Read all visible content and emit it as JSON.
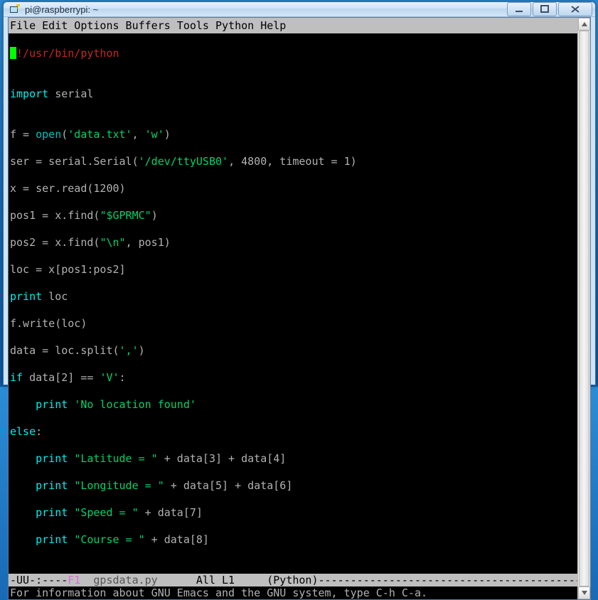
{
  "window": {
    "title": "pi@raspberrypi: ~"
  },
  "menubar": "File Edit Options Buffers Tools Python Help",
  "code": {
    "shebang_bang": "#",
    "shebang_rest": "!/usr/bin/python",
    "blank": "",
    "l_import": "import",
    "l_import_mod": " serial",
    "l_fopen_1": "f = ",
    "l_fopen_open": "open",
    "l_fopen_2": "(",
    "l_fopen_s1": "'data.txt'",
    "l_fopen_3": ", ",
    "l_fopen_s2": "'w'",
    "l_fopen_4": ")",
    "l_ser_1": "ser = serial.Serial(",
    "l_ser_s1": "'/dev/ttyUSB0'",
    "l_ser_2": ", 4800, timeout = 1)",
    "l_x": "x = ser.read(1200)",
    "l_pos1_1": "pos1 = x.find(",
    "l_pos1_s": "\"$GPRMC\"",
    "l_pos1_2": ")",
    "l_pos2_1": "pos2 = x.find(",
    "l_pos2_s": "\"\\n\"",
    "l_pos2_2": ", pos1)",
    "l_loc": "loc = x[pos1:pos2]",
    "l_print_kw": "print",
    "l_print_loc": " loc",
    "l_fwrite": "f.write(loc)",
    "l_data_1": "data = loc.split(",
    "l_data_s": "','",
    "l_data_2": ")",
    "l_if_kw": "if",
    "l_if_1": " data[2] == ",
    "l_if_s": "'V'",
    "l_if_2": ":",
    "l_nlf_1": "    ",
    "l_nlf_s": "'No location found'",
    "l_else_kw": "else",
    "l_else_c": ":",
    "l_lat_s": "\"Latitude = \"",
    "l_lat_2": " + data[3] + data[4]",
    "l_lon_s": "\"Longitude = \"",
    "l_lon_2": " + data[5] + data[6]",
    "l_spd_s": "\"Speed = \"",
    "l_spd_2": " + data[7]",
    "l_crs_s": "\"Course = \"",
    "l_crs_2": " + data[8]",
    "indent4": "    ",
    "space": " "
  },
  "modeline": {
    "left": "-UU-:----",
    "f1": "F1",
    "gap1": "  ",
    "file": "gpsdata.py",
    "gap2": "      ",
    "pos": "All L1",
    "gap3": "     ",
    "mode": "(Python)",
    "dash": "---------------------------------------------"
  },
  "echo": "For information about GNU Emacs and the GNU system, type C-h C-a."
}
